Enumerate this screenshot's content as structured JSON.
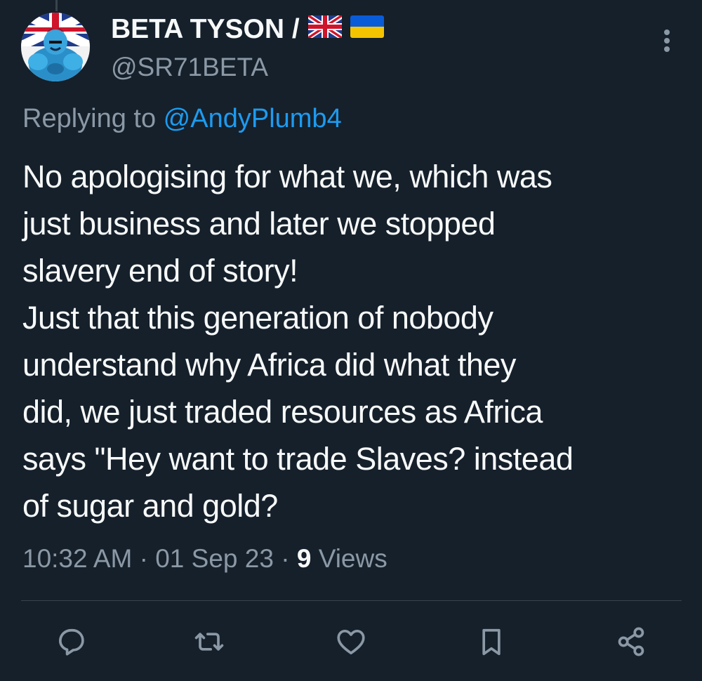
{
  "tweet": {
    "author": {
      "display_name": "BETA TYSON /",
      "handle": "@SR71BETA",
      "flags": [
        "uk-flag",
        "ukraine-flag"
      ]
    },
    "replying_prefix": "Replying to ",
    "replying_to": "@AndyPlumb4",
    "text_lines": [
      "No apologising for what we, which  was",
      "just business and later we stopped",
      "slavery end of story!",
      "Just that this generation of nobody",
      "understand why Africa did what they",
      "did, we just traded resources as Africa",
      "says \"Hey want to trade Slaves? instead",
      "of sugar and gold?"
    ],
    "time": "10:32 AM",
    "separator": "·",
    "date": "01 Sep 23",
    "views_count": "9",
    "views_label": "Views"
  },
  "actions": [
    {
      "name": "reply-icon"
    },
    {
      "name": "retweet-icon"
    },
    {
      "name": "like-icon"
    },
    {
      "name": "bookmark-icon"
    },
    {
      "name": "share-icon"
    }
  ],
  "colors": {
    "background": "#15202b",
    "text_primary": "#f7f9f9",
    "text_secondary": "#8b98a5",
    "accent": "#1d9bf0",
    "divider": "#38444d"
  }
}
